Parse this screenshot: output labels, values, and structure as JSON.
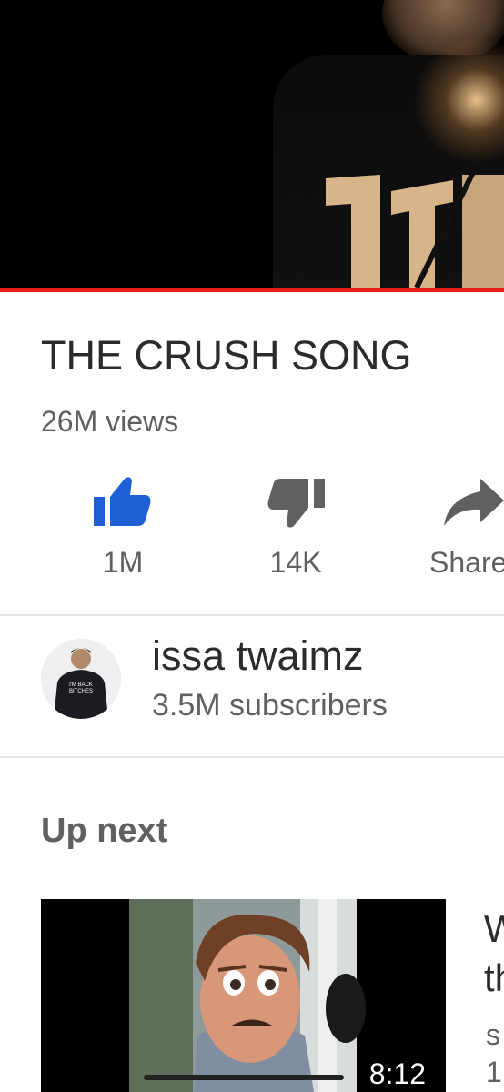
{
  "video": {
    "title": "THE CRUSH SONG",
    "views": "26M views",
    "progress_percent": 100
  },
  "actions": {
    "like_count": "1M",
    "dislike_count": "14K",
    "share_label": "Share"
  },
  "channel": {
    "name": "issa twaimz",
    "subscribers": "3.5M subscribers",
    "avatar_shirt_text": "I'M BACK BITCHES"
  },
  "up_next": {
    "heading": "Up next",
    "items": [
      {
        "duration": "8:12",
        "title_line1": "W",
        "title_line2": "th",
        "channel": "s",
        "meta": "1"
      }
    ]
  },
  "colors": {
    "accent_red": "#e62117",
    "like_blue": "#1e5fd6",
    "icon_gray": "#606060"
  },
  "icons": {
    "like": "thumbs-up-icon",
    "dislike": "thumbs-down-icon",
    "share": "share-arrow-icon"
  }
}
